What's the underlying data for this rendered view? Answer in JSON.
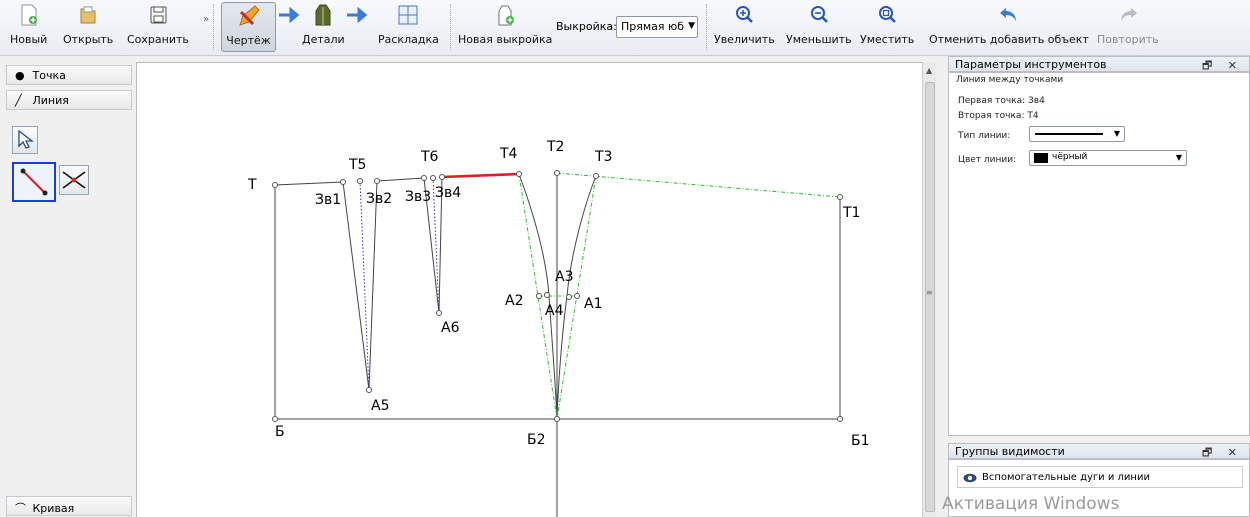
{
  "toolbar": {
    "new_label": "Новый",
    "open_label": "Открыть",
    "save_label": "Сохранить",
    "more_glyph": "»",
    "draft_label": "Чертёж",
    "details_label": "Детали",
    "layout_label": "Раскладка",
    "new_pattern_label": "Новая выкройка",
    "pattern_label": "Выкройка:",
    "pattern_value": "Прямая юб",
    "zoom_in_label": "Увеличить",
    "zoom_out_label": "Уменьшить",
    "fit_label": "Уместить",
    "undo_label": "Отменить добавить объект",
    "redo_label": "Повторить"
  },
  "toolbox": {
    "point_tab": "Точка",
    "line_tab": "Линия",
    "curve_tab": "Кривая",
    "point_icon": "●",
    "line_icon": "╱",
    "curve_icon": "⌒"
  },
  "canvas": {
    "labels": {
      "T": "Т",
      "T1": "Т1",
      "T2": "Т2",
      "T3": "Т3",
      "T4": "Т4",
      "T5": "Т5",
      "T6": "Т6",
      "Zv1": "Зв1",
      "Zv2": "Зв2",
      "Zv3": "Зв3",
      "Zv4": "Зв4",
      "A1": "А1",
      "A2": "А2",
      "A3": "А3",
      "A4": "А4",
      "A5": "А5",
      "A6": "А6",
      "B": "Б",
      "B1": "Б1",
      "B2": "Б2"
    },
    "colors": {
      "selected_line": "#e02020",
      "aux_blue": "#2c2cd0",
      "aux_green": "#2dbb2d"
    }
  },
  "params_panel": {
    "title": "Параметры инструментов",
    "ctrls": "🗗 ✕",
    "tool_name": "Линия между точками",
    "first_point": "Первая точка: Зв4",
    "second_point": "Вторая точка: Т4",
    "line_type_label": "Тип линии:",
    "line_color_label": "Цвет линии:",
    "line_color_value": "чёрный"
  },
  "visibility_panel": {
    "title": "Группы видимости",
    "ctrls": "🗗 ✕",
    "item_label": "Вспомогательные дуги и линии"
  },
  "watermark": "Активация Windows"
}
